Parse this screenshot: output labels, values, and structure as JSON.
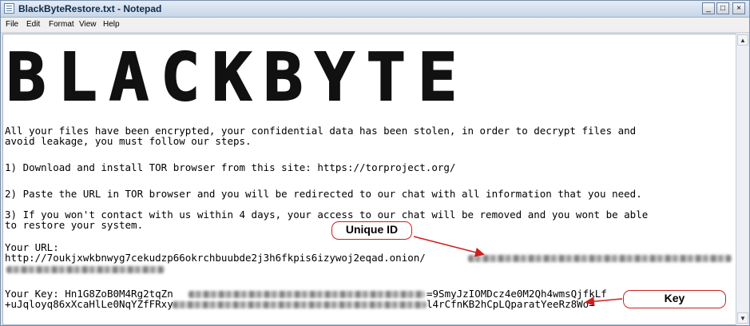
{
  "window": {
    "title": "BlackByteRestore.txt - Notepad",
    "controls": {
      "minimize": "_",
      "maximize": "□",
      "close": "×"
    }
  },
  "menu": [
    "File",
    "Edit",
    "Format",
    "View",
    "Help"
  ],
  "document": {
    "logo_text": "BLACKBYTE",
    "intro_line1": "All your files have been encrypted, your confidential data has been stolen, in order to decrypt files and",
    "intro_line2": "avoid leakage, you must follow our steps.",
    "step1": "1) Download and install TOR browser from this site: https://torproject.org/",
    "step2": "2) Paste the URL in TOR browser and you will be redirected to our chat with all information that you need.",
    "step3_line1": "3) If you won't contact with us within 4 days, your access to our chat will be removed and you wont be able",
    "step3_line2": "to restore your system.",
    "url_label": "Your URL:",
    "url_value": "http://7oukjxwkbnwyg7cekudzp66okrchbuubde2j3h6fkpis6izywoj2eqad.onion/",
    "key_label": "Your Key: ",
    "key_part1": "Hn1G8ZoB0M4Rg2tqZn",
    "key_part2": "=9SmyJzIOMDcz4e0M2Qh4wmsQjfkLf",
    "key_line2_part1": "+uJqloyq86xXcaHlLe0NqYZfFRxy",
    "key_line2_part2": "l4rCfnKB2hCpLQparatYeeRz8Wo="
  },
  "annotations": {
    "unique_id_label": "Unique ID",
    "key_label": "Key",
    "color": "#cc1f1f"
  },
  "scrollbar": {
    "up_icon": "▲",
    "down_icon": "▼"
  }
}
